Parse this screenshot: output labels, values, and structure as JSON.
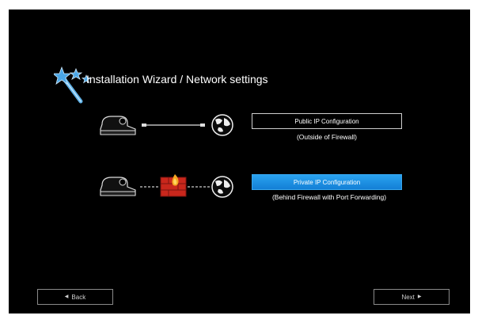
{
  "header": {
    "title": "Installation Wizard / Network settings"
  },
  "options": {
    "public": {
      "label": "Public IP Configuration",
      "note": "(Outside of Firewall)"
    },
    "private": {
      "label": "Private IP Configuration",
      "note": "(Behind Firewall with Port Forwarding)",
      "selected": true
    }
  },
  "nav": {
    "back_label": "Back",
    "next_label": "Next"
  },
  "icons": {
    "wizard": "magic-wand-icon",
    "device": "video-conference-device-icon",
    "globe": "globe-icon",
    "firewall": "firewall-icon",
    "back": "triangle-left-icon",
    "next": "triangle-right-icon"
  },
  "colors": {
    "background": "#000000",
    "selected": "#1e90e8",
    "text": "#ffffff"
  }
}
